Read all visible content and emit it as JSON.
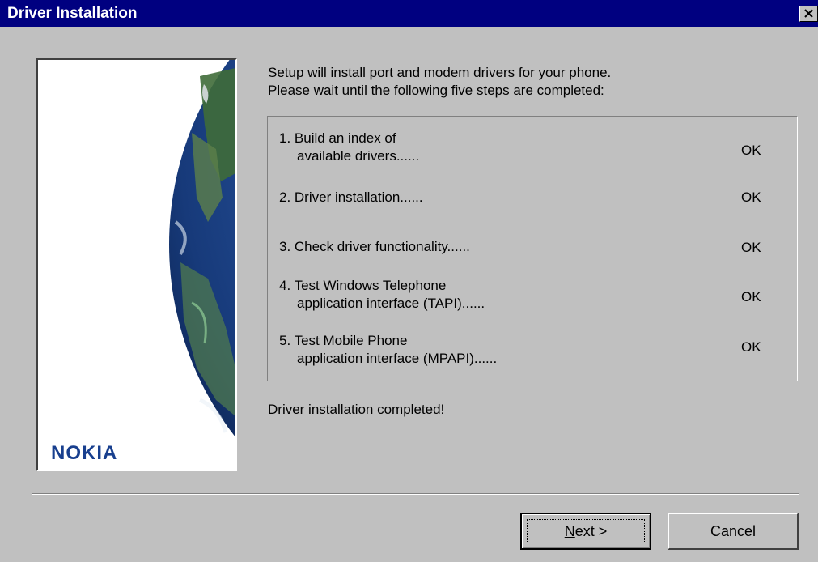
{
  "window": {
    "title": "Driver Installation",
    "close_icon": "close-icon"
  },
  "side_panel": {
    "image": "globe-illustration",
    "logo_text": "NOKIA",
    "logo_color": "#183f8e"
  },
  "intro": {
    "line1": "Setup will install port and modem drivers for your phone.",
    "line2": "Please wait until the following five steps are completed:"
  },
  "steps": [
    {
      "line1": "1. Build an index of",
      "line2": "available drivers......",
      "status": "OK"
    },
    {
      "line1": "2. Driver installation......",
      "line2": "",
      "status": "OK"
    },
    {
      "line1": "3. Check driver functionality......",
      "line2": "",
      "status": "OK"
    },
    {
      "line1": "4. Test Windows Telephone",
      "line2": "application interface (TAPI)......",
      "status": "OK"
    },
    {
      "line1": "5. Test Mobile Phone",
      "line2": "application interface (MPAPI)......",
      "status": "OK"
    }
  ],
  "completion_message": "Driver installation completed!",
  "buttons": {
    "next_mnemonic": "N",
    "next_rest": "ext >",
    "cancel": "Cancel"
  },
  "colors": {
    "titlebar": "#000080",
    "dialog_background": "#c0c0c0"
  }
}
